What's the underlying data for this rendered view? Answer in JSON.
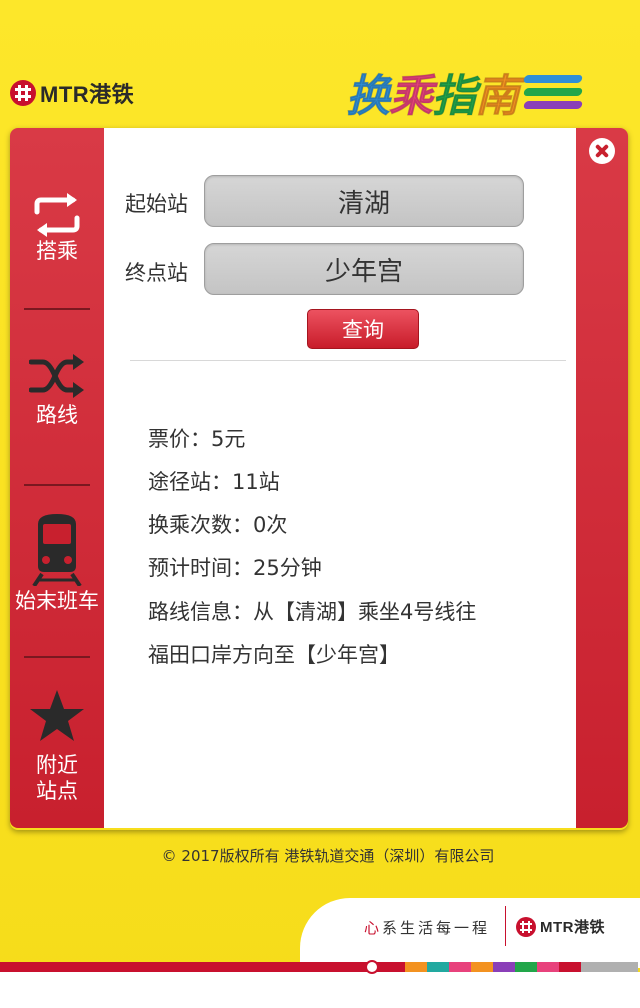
{
  "header": {
    "brand": "MTR港铁",
    "title_chars": [
      "换",
      "乘",
      "指",
      "南"
    ],
    "title_colors": [
      "#2f8fd6",
      "#e8427c",
      "#22a64a",
      "#f39220"
    ],
    "title_line_colors": [
      "#2f8fd6",
      "#22a64a",
      "#8a3fb8"
    ]
  },
  "sidebar": {
    "items": [
      {
        "label": "搭乘",
        "icon": "transfer-arrows-icon"
      },
      {
        "label": "路线",
        "icon": "shuffle-route-icon"
      },
      {
        "label": "始末班车",
        "icon": "train-icon"
      },
      {
        "label": "附近站点",
        "icon": "star-icon"
      }
    ]
  },
  "form": {
    "start_label": "起始站",
    "start_value": "清湖",
    "end_label": "终点站",
    "end_value": "少年宫",
    "query_label": "查询"
  },
  "result": {
    "fare": "票价：5元",
    "stops": "途径站：11站",
    "transfers": "换乘次数：0次",
    "time": "预计时间：25分钟",
    "route_line1": "路线信息：从【清湖】乘坐4号线往",
    "route_line2": "福田口岸方向至【少年宫】"
  },
  "copyright": "© 2017版权所有 港铁轨道交通（深圳）有限公司",
  "footer": {
    "slogan_heart": "心",
    "slogan_rest": "系生活每一程",
    "brand": "MTR港铁",
    "rail_colors": [
      "#c8102e",
      "#c8102e",
      "#f39220",
      "#22a9a0",
      "#e8427c",
      "#f39220",
      "#8a3fb8",
      "#22a64a",
      "#e8427c",
      "#c8102e",
      "#b0b0b0"
    ]
  },
  "accent": "#c8202e"
}
